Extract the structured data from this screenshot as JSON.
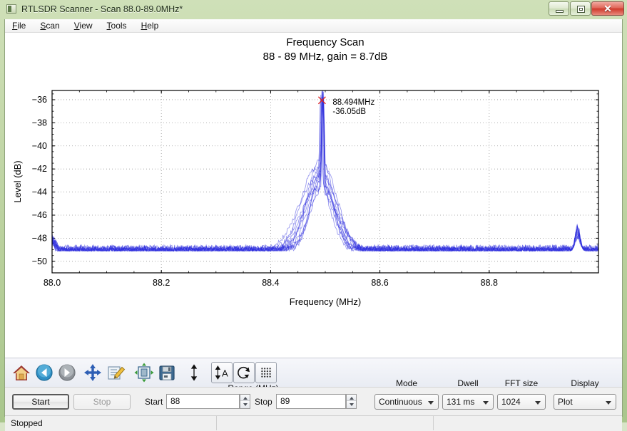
{
  "window": {
    "title": "RTLSDR Scanner - Scan 88.0-89.0MHz*",
    "app_icon": "app-icon",
    "buttons": {
      "minimize": "minimize-icon",
      "maximize": "restore-icon",
      "close": "✕"
    }
  },
  "menu": {
    "items": [
      {
        "accel": "F",
        "rest": "ile"
      },
      {
        "accel": "S",
        "rest": "can"
      },
      {
        "accel": "V",
        "rest": "iew"
      },
      {
        "accel": "T",
        "rest": "ools"
      },
      {
        "accel": "H",
        "rest": "elp"
      }
    ]
  },
  "toolbar": {
    "icons": [
      {
        "name": "home-icon",
        "tip": "Home"
      },
      {
        "name": "back-arrow-icon",
        "tip": "Back"
      },
      {
        "name": "forward-arrow-icon",
        "tip": "Forward"
      },
      {
        "name": "pan-move-icon",
        "tip": "Pan"
      },
      {
        "name": "edit-icon",
        "tip": "Edit"
      },
      {
        "name": "configure-subplots-icon",
        "tip": "Configure subplots"
      },
      {
        "name": "save-floppy-icon",
        "tip": "Save"
      },
      {
        "name": "vertical-arrow-icon",
        "tip": "Autoscale axis"
      },
      {
        "name": "autoscale-a-icon",
        "tip": "Auto scale"
      },
      {
        "name": "refresh-icon",
        "tip": "Retain / refresh"
      },
      {
        "name": "grid-dots-icon",
        "tip": "Grid"
      }
    ],
    "range_group_label": "Range (MHz)"
  },
  "controls": {
    "start_button": "Start",
    "stop_button": "Stop",
    "range_start_label": "Start",
    "range_start_value": "88",
    "range_stop_label": "Stop",
    "range_stop_value": "89",
    "mode_label": "Mode",
    "mode_value": "Continuous",
    "dwell_label": "Dwell",
    "dwell_value": "131 ms",
    "fft_label": "FFT size",
    "fft_value": "1024",
    "display_label": "Display",
    "display_value": "Plot"
  },
  "statusbar": {
    "text": "Stopped"
  },
  "chart_data": {
    "type": "line",
    "title": "Frequency Scan",
    "subtitle": "88 - 89 MHz, gain = 8.7dB",
    "xlabel": "Frequency (MHz)",
    "ylabel": "Level (dB)",
    "xlim": [
      88.0,
      89.0
    ],
    "ylim": [
      -51.0,
      -35.2
    ],
    "xticks": [
      "88.0",
      "88.2",
      "88.4",
      "88.6",
      "88.8"
    ],
    "xtick_values": [
      88.0,
      88.2,
      88.4,
      88.6,
      88.8
    ],
    "yticks": [
      "−36",
      "−38",
      "−40",
      "−42",
      "−44",
      "−46",
      "−48",
      "−50"
    ],
    "ytick_values": [
      -36,
      -38,
      -40,
      -42,
      -44,
      -46,
      -48,
      -50
    ],
    "grid": true,
    "grid_style": "dotted",
    "legend": "none",
    "series_color": "#2b2bdd",
    "sweep_count": 12,
    "noise_floor_db": -49.1,
    "peak": {
      "marker": "x",
      "marker_color": "#dd2222",
      "frequency_mhz": 88.494,
      "level_db": -36.05,
      "label_freq": "88.494MHz",
      "label_level": "-36.05dB"
    },
    "features": [
      {
        "center_mhz": 88.494,
        "peak_db": -36.05,
        "width_mhz": 0.004,
        "kind": "carrier-spike"
      },
      {
        "center_mhz": 88.488,
        "peak_db": -42.2,
        "width_mhz": 0.055,
        "kind": "fm-shoulder"
      },
      {
        "center_mhz": 88.962,
        "peak_db": -47.4,
        "width_mhz": 0.006,
        "kind": "spur"
      }
    ],
    "x": [
      88.0,
      88.05,
      88.1,
      88.15,
      88.2,
      88.25,
      88.3,
      88.35,
      88.4,
      88.42,
      88.44,
      88.46,
      88.47,
      88.48,
      88.49,
      88.494,
      88.5,
      88.51,
      88.52,
      88.54,
      88.56,
      88.6,
      88.65,
      88.7,
      88.75,
      88.8,
      88.85,
      88.9,
      88.96,
      89.0
    ],
    "y": [
      -48.3,
      -49.1,
      -49.2,
      -49.1,
      -49.0,
      -49.2,
      -49.1,
      -49.0,
      -48.9,
      -48.2,
      -46.6,
      -44.2,
      -42.6,
      -41.8,
      -39.0,
      -36.05,
      -40.5,
      -43.6,
      -45.9,
      -48.4,
      -49.2,
      -49.3,
      -49.2,
      -49.0,
      -49.1,
      -48.9,
      -49.0,
      -48.9,
      -47.4,
      -49.0
    ]
  }
}
